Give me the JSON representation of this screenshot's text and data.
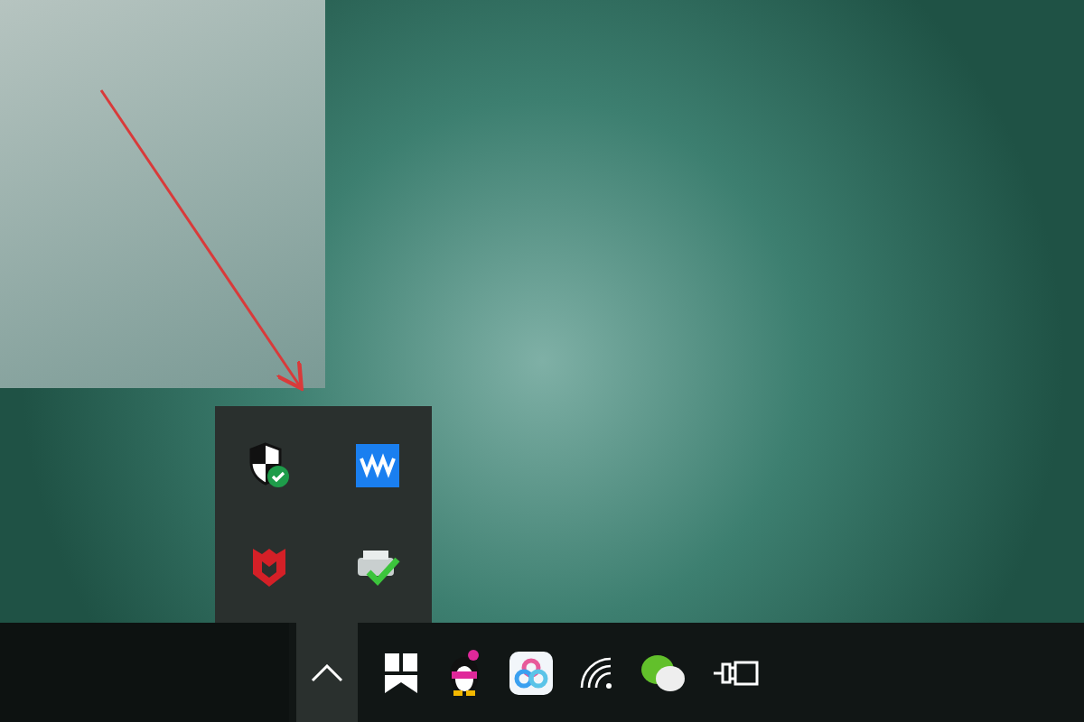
{
  "tray_overflow": {
    "expanded": true
  }
}
